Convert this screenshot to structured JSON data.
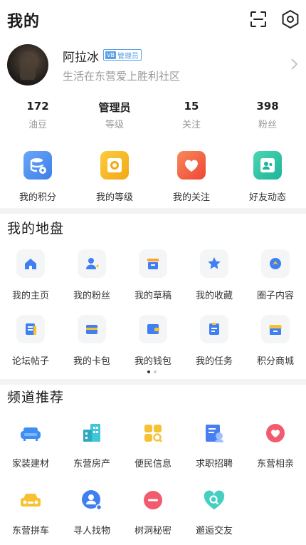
{
  "header": {
    "title": "我的"
  },
  "profile": {
    "name": "阿拉冰",
    "badge_prefix": "VB",
    "badge": "管理员",
    "bio": "生活在东营爱上胜利社区"
  },
  "stats": [
    {
      "value": "172",
      "label": "油豆"
    },
    {
      "value": "管理员",
      "label": "等级"
    },
    {
      "value": "15",
      "label": "关注"
    },
    {
      "value": "398",
      "label": "粉丝"
    }
  ],
  "quick_actions": [
    {
      "label": "我的积分",
      "icon": "database-icon",
      "color": "#4d8ff0"
    },
    {
      "label": "我的等级",
      "icon": "medal-icon",
      "color": "#f7b928"
    },
    {
      "label": "我的关注",
      "icon": "heart-icon",
      "color": "#f2613f"
    },
    {
      "label": "好友动态",
      "icon": "friends-icon",
      "color": "#2fc3a5"
    }
  ],
  "territory": {
    "title": "我的地盘",
    "items": [
      {
        "label": "我的主页",
        "icon": "home-icon"
      },
      {
        "label": "我的粉丝",
        "icon": "fans-icon"
      },
      {
        "label": "我的草稿",
        "icon": "draft-icon"
      },
      {
        "label": "我的收藏",
        "icon": "star-icon"
      },
      {
        "label": "圈子内容",
        "icon": "circle-icon"
      },
      {
        "label": "论坛帖子",
        "icon": "post-icon"
      },
      {
        "label": "我的卡包",
        "icon": "card-icon"
      },
      {
        "label": "我的钱包",
        "icon": "wallet-icon"
      },
      {
        "label": "我的任务",
        "icon": "task-icon"
      },
      {
        "label": "积分商城",
        "icon": "shop-icon"
      }
    ]
  },
  "channels": {
    "title": "频道推荐",
    "items": [
      {
        "label": "家装建材",
        "icon": "sofa-icon",
        "color": "#3d8ff5"
      },
      {
        "label": "东营房产",
        "icon": "building-icon",
        "color": "#3ec7d8"
      },
      {
        "label": "便民信息",
        "icon": "apps-icon",
        "color": "#f6c234"
      },
      {
        "label": "求职招聘",
        "icon": "resume-icon",
        "color": "#4a7ef0"
      },
      {
        "label": "东营相亲",
        "icon": "love-icon",
        "color": "#f25a6e"
      },
      {
        "label": "东营拼车",
        "icon": "car-icon",
        "color": "#f6c234"
      },
      {
        "label": "寻人找物",
        "icon": "search-person-icon",
        "color": "#3f7ff2"
      },
      {
        "label": "树洞秘密",
        "icon": "secret-icon",
        "color": "#f25a6e"
      },
      {
        "label": "邂逅交友",
        "icon": "heart-search-icon",
        "color": "#45cfc2"
      }
    ]
  },
  "colors": {
    "accent": "#4d8ff0",
    "badge": "#5aa0e6",
    "muted_text": "#999999"
  }
}
